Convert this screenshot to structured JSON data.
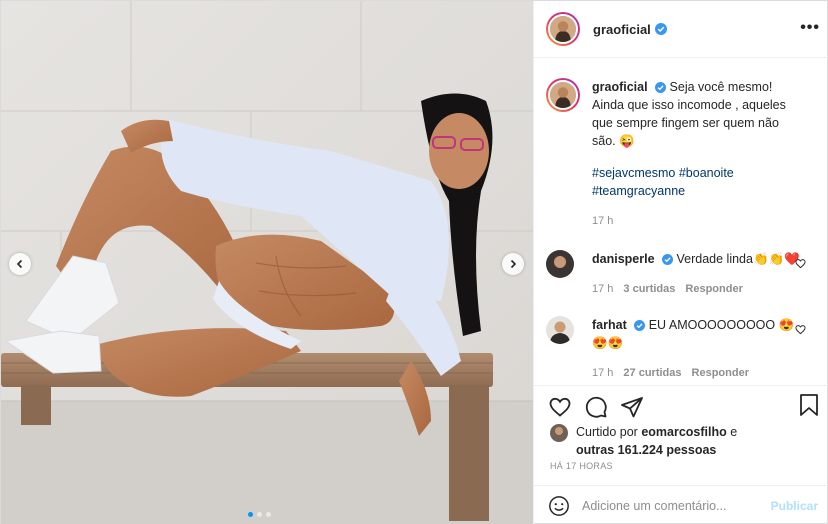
{
  "post": {
    "username": "graoficial",
    "more_icon": "more-horizontal-icon",
    "caption": {
      "username": "graoficial",
      "text": "Seja você mesmo! Ainda que isso incomode , aqueles que sempre fingem ser quem não são. 😜",
      "hashtags": "#sejavcmesmo #boanoite #teamgracyanne",
      "time": "17 h"
    },
    "comments": [
      {
        "username": "danisperle",
        "text": "Verdade linda👏👏❤️",
        "time": "17 h",
        "likes": "3 curtidas",
        "reply": "Responder"
      },
      {
        "username": "farhat",
        "text": "EU AMOOOOOOOOO 😍😍😍",
        "time": "17 h",
        "likes": "27 curtidas",
        "reply": "Responder"
      }
    ],
    "liked_by": {
      "prefix": "Curtido por",
      "user": "eomarcosfilho",
      "middle": "e",
      "others": "outras 161.224 pessoas"
    },
    "posted_ago": "HÁ 17 HORAS",
    "composer": {
      "placeholder": "Adicione um comentário...",
      "publish": "Publicar"
    },
    "carousel": {
      "total": 3,
      "active": 1
    }
  },
  "colors": {
    "accent": "#0095f6",
    "hashtag": "#00376b",
    "muted": "#8e8e8e",
    "publish_disabled": "#b2dffc"
  }
}
